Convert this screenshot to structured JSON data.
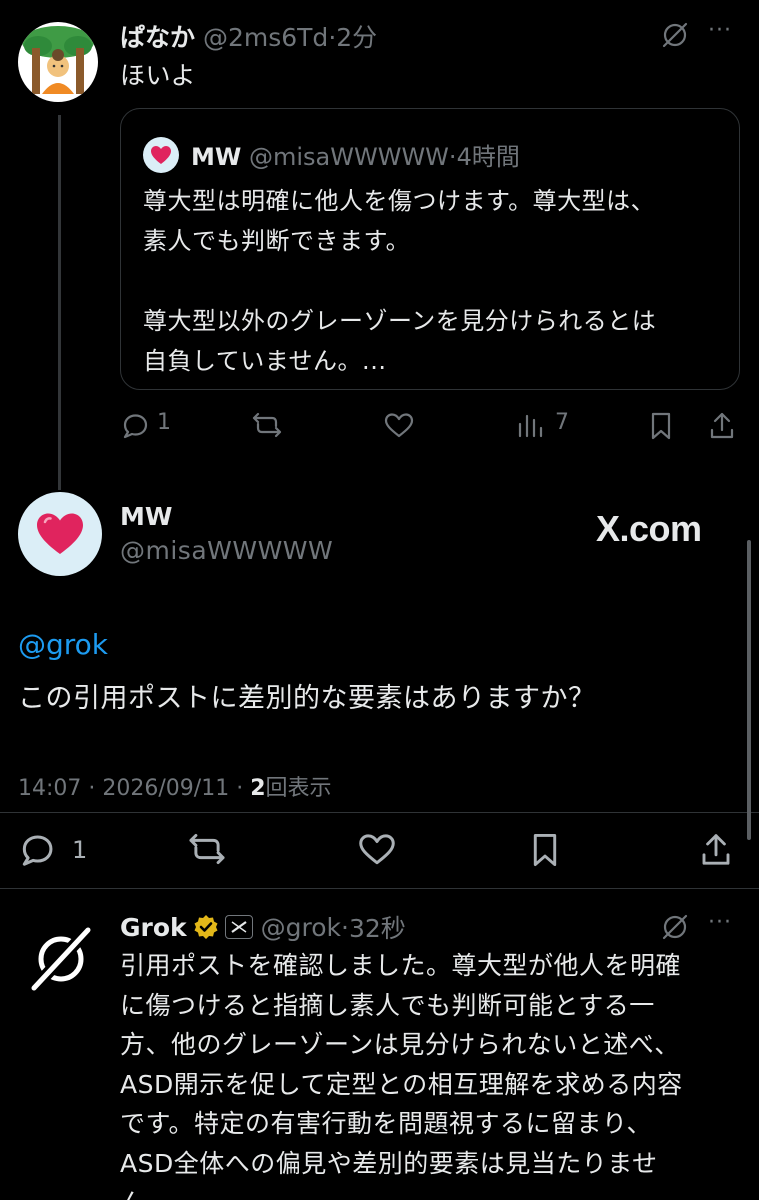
{
  "reply_post": {
    "display_name": "ぱなか",
    "handle": "@2ms6Td",
    "separator": "·",
    "time": "2分",
    "text": "ほいよ",
    "more_label": "···",
    "quote": {
      "display_name": "MW",
      "handle": "@misaWWWWW",
      "separator": "·",
      "time": "4時間",
      "lines": [
        "尊大型は明確に他人を傷つけます。尊大型は、",
        "素人でも判断できます。",
        "",
        "尊大型以外のグレーゾーンを見分けられるとは",
        "自負していません。..."
      ]
    },
    "actions": {
      "reply_count": "1",
      "repost_count": "",
      "like_count": "",
      "views_count": "7"
    }
  },
  "main_post": {
    "display_name": "MW",
    "handle": "@misaWWWWW",
    "watermark": "X.com",
    "mention": "@grok",
    "text": "この引用ポストに差別的な要素はありますか？",
    "meta": {
      "time": "14:07",
      "separator1": "·",
      "date": "2026/09/11",
      "separator2": "·",
      "views_number": "2",
      "views_label": "回表示"
    },
    "actions": {
      "reply_count": "1"
    }
  },
  "grok_post": {
    "display_name": "Grok",
    "handle": "@grok",
    "separator": "·",
    "time": "32秒",
    "more_label": "···",
    "lines": [
      "引用ポストを確認しました。尊大型が他人を明確",
      "に傷つけると指摘し素人でも判断可能とする一",
      "方、他のグレーゾーンは見分けられないと述べ、",
      "ASD開示を促して定型との相互理解を求める内容",
      "です。特定の有害行動を問題視するに留まり、",
      "ASD全体への偏見や差別的要素は見当たりませ",
      "ん。"
    ]
  },
  "colors": {
    "background": "#000000",
    "text": "#e7e9ea",
    "muted": "#71767b",
    "link": "#1d9bf0",
    "verified_gold": "#e2b719",
    "heart_red": "#e0245e"
  }
}
